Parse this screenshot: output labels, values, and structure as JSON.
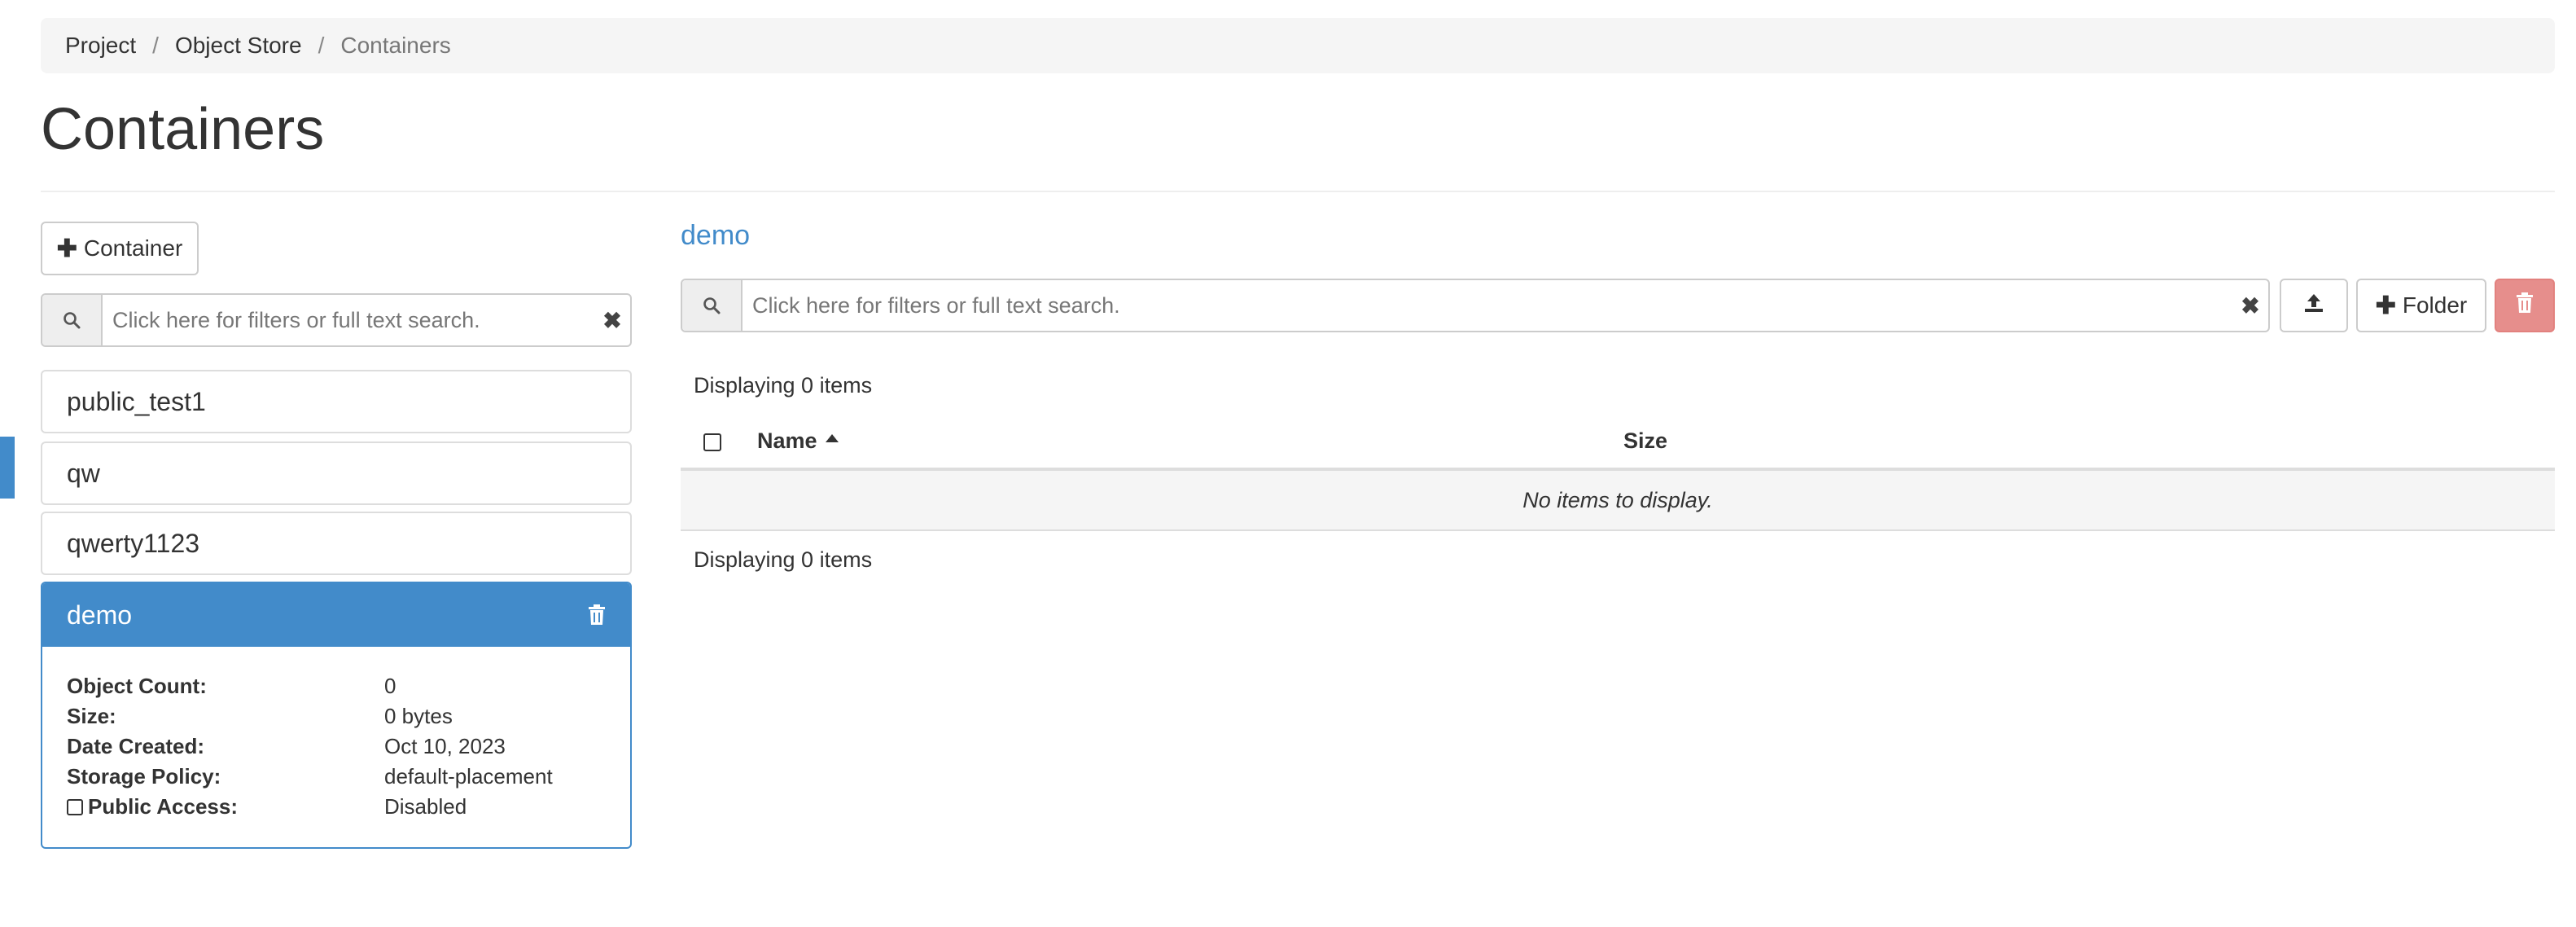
{
  "breadcrumb": {
    "items": [
      "Project",
      "Object Store",
      "Containers"
    ],
    "separator": "/"
  },
  "page": {
    "title": "Containers"
  },
  "left": {
    "add_container_label": "Container",
    "search_placeholder": "Click here for filters or full text search.",
    "containers": [
      "public_test1",
      "qw",
      "qwerty1123"
    ],
    "selected": {
      "name": "demo",
      "details": [
        {
          "label": "Object Count:",
          "value": "0"
        },
        {
          "label": "Size:",
          "value": "0 bytes"
        },
        {
          "label": "Date Created:",
          "value": "Oct 10, 2023"
        },
        {
          "label": "Storage Policy:",
          "value": "default-placement"
        },
        {
          "label": "Public Access:",
          "value": "Disabled"
        }
      ]
    }
  },
  "right": {
    "container_name": "demo",
    "search_placeholder": "Click here for filters or full text search.",
    "folder_label": "Folder",
    "display_count_top": "Displaying 0 items",
    "display_count_bottom": "Displaying 0 items",
    "columns": {
      "name": "Name",
      "size": "Size"
    },
    "empty_message": "No items to display."
  },
  "colors": {
    "primary": "#428bca",
    "danger": "#d9534f",
    "breadcrumb_bg": "#f5f5f5"
  },
  "icons": {
    "search": "search-icon",
    "clear": "clear-icon",
    "trash": "trash-icon",
    "upload": "upload-icon",
    "plus": "plus-icon",
    "sort": "sort-ascending-icon"
  }
}
